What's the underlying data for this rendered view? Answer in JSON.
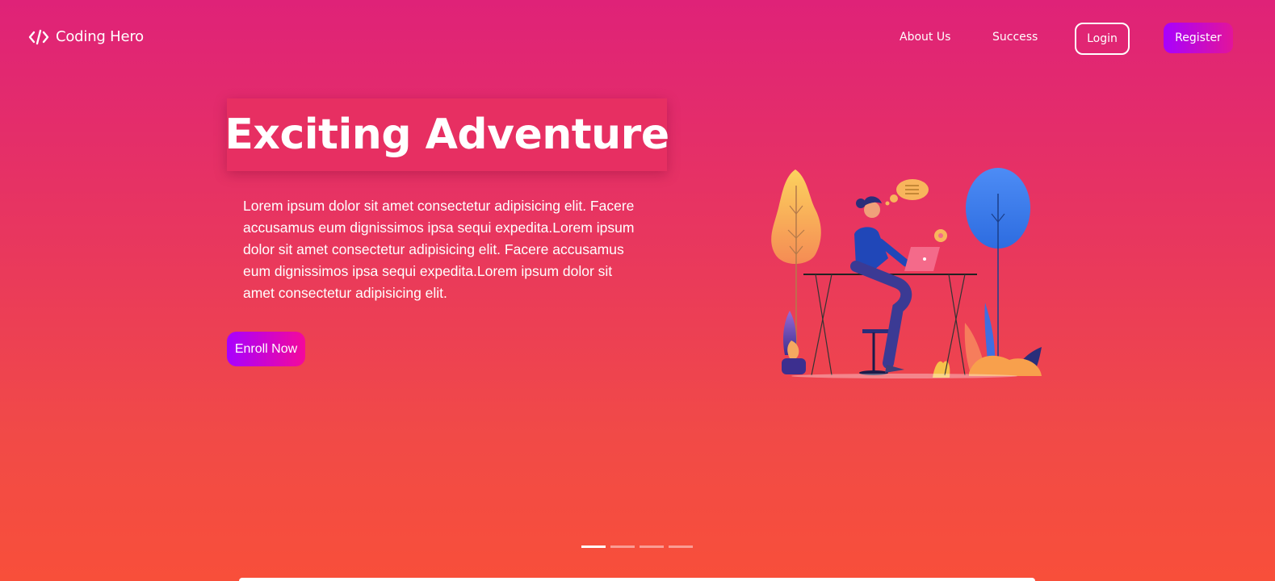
{
  "nav": {
    "brand_icon": "code-icon",
    "brand_name": "Coding Hero",
    "links": [
      "About Us",
      "Success"
    ],
    "login_label": "Login",
    "register_label": "Register"
  },
  "hero": {
    "title": "Exciting Adventure",
    "description": "Lorem ipsum dolor sit amet consectetur adipisicing elit. Facere accusamus eum dignissimos ipsa sequi expedita.Lorem ipsum dolor sit amet consectetur adipisicing elit. Facere accusamus eum dignissimos ipsa sequi expedita.Lorem ipsum dolor sit amet consectetur adipisicing elit.",
    "cta_label": "Enroll Now",
    "illustration": "woman-working-on-laptop-illustration"
  },
  "carousel": {
    "slide_count": 4,
    "active_index": 0
  },
  "colors": {
    "gradient_top": "#df2278",
    "gradient_bottom": "#f84f3a",
    "button_gradient_start": "#a800ff",
    "button_gradient_end": "#e2149a",
    "title_box": "#e72f62"
  }
}
